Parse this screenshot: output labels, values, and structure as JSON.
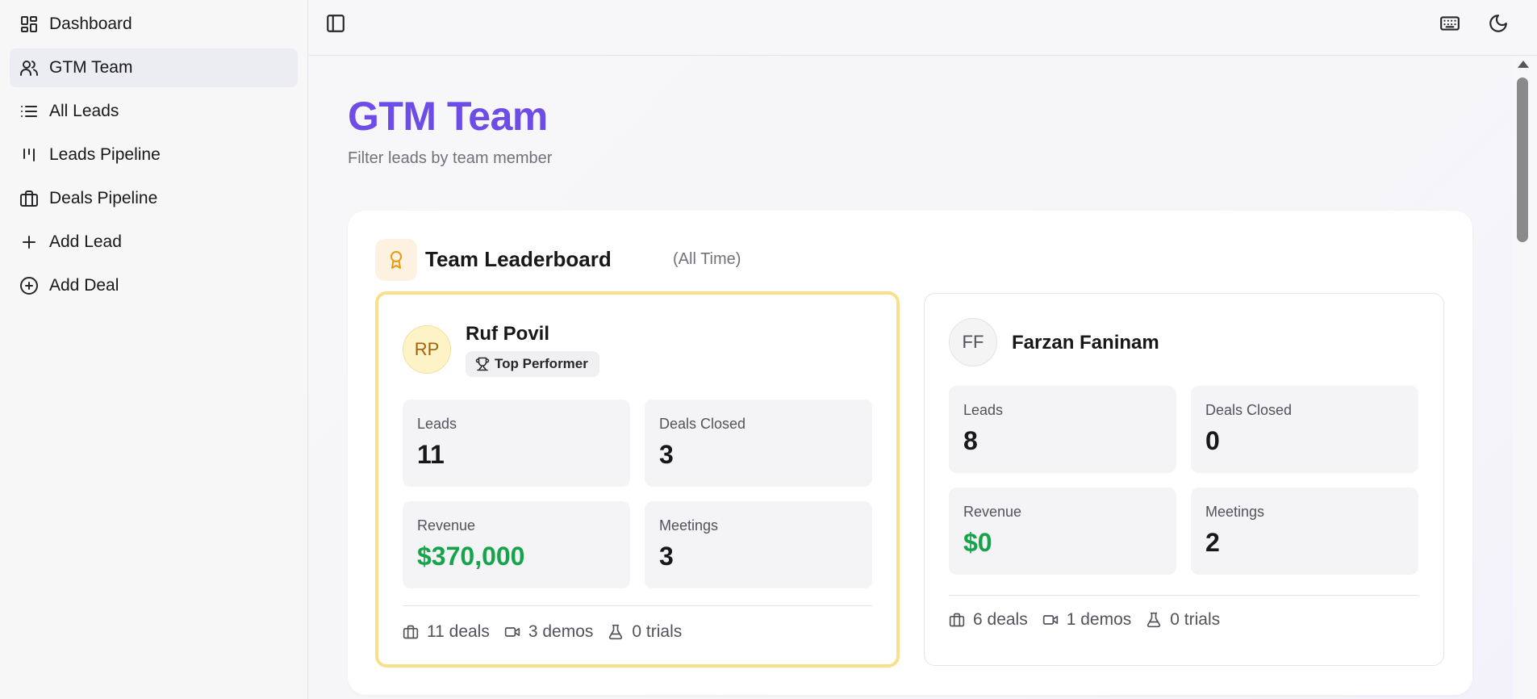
{
  "sidebar": {
    "items": [
      {
        "label": "Dashboard",
        "icon": "layout-dashboard-icon",
        "active": false
      },
      {
        "label": "GTM Team",
        "icon": "users-icon",
        "active": true
      },
      {
        "label": "All Leads",
        "icon": "list-icon",
        "active": false
      },
      {
        "label": "Leads Pipeline",
        "icon": "kanban-icon",
        "active": false
      },
      {
        "label": "Deals Pipeline",
        "icon": "briefcase-icon",
        "active": false
      },
      {
        "label": "Add Lead",
        "icon": "plus-icon",
        "active": false
      },
      {
        "label": "Add Deal",
        "icon": "plus-circle-icon",
        "active": false
      }
    ]
  },
  "topbar": {
    "sidebar_toggle_icon": "panel-left-icon",
    "keyboard_icon": "keyboard-icon",
    "theme_icon": "moon-icon"
  },
  "page": {
    "title": "GTM Team",
    "subtitle": "Filter leads by team member"
  },
  "leaderboard": {
    "title": "Team Leaderboard",
    "range": "(All Time)",
    "icon": "award-icon",
    "members": [
      {
        "initials": "RP",
        "name": "Ruf Povil",
        "badge": "Top Performer",
        "stats": {
          "leads_label": "Leads",
          "leads": "11",
          "deals_closed_label": "Deals Closed",
          "deals_closed": "3",
          "revenue_label": "Revenue",
          "revenue": "$370,000",
          "meetings_label": "Meetings",
          "meetings": "3"
        },
        "footer": {
          "deals": "11 deals",
          "demos": "3 demos",
          "trials": "0 trials"
        }
      },
      {
        "initials": "FF",
        "name": "Farzan Faninam",
        "stats": {
          "leads_label": "Leads",
          "leads": "8",
          "deals_closed_label": "Deals Closed",
          "deals_closed": "0",
          "revenue_label": "Revenue",
          "revenue": "$0",
          "meetings_label": "Meetings",
          "meetings": "2"
        },
        "footer": {
          "deals": "6 deals",
          "demos": "1 demos",
          "trials": "0 trials"
        }
      }
    ]
  },
  "colors": {
    "accent": "#6d4ce8",
    "revenue": "#16a34a",
    "top_border": "#f8e08a",
    "award": "#e69b12"
  }
}
